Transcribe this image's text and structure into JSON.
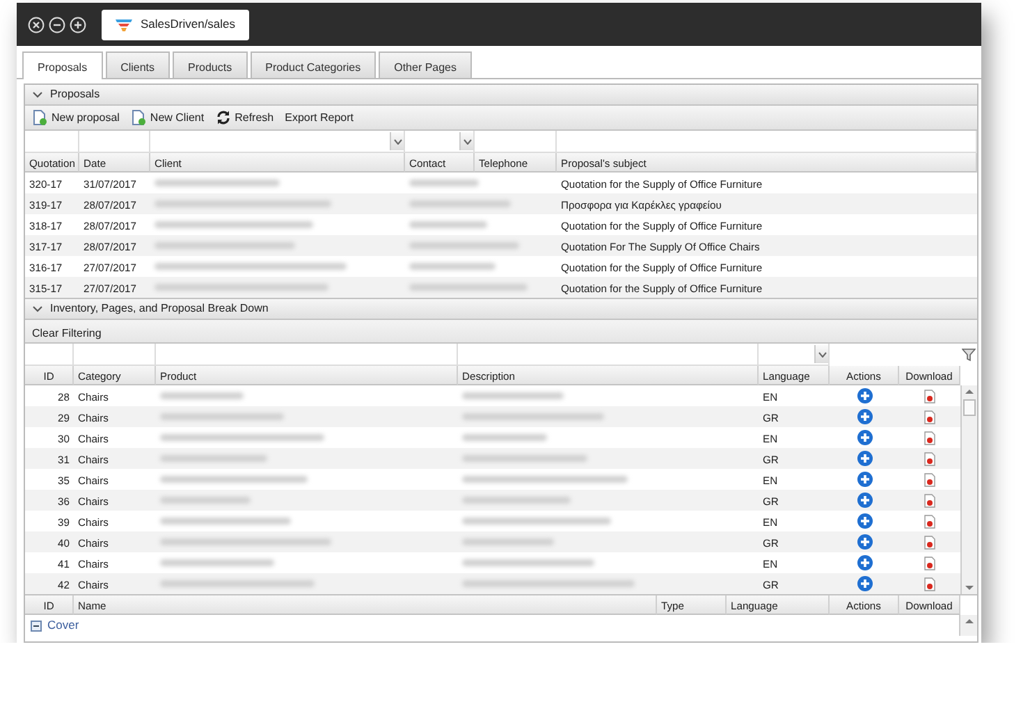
{
  "window": {
    "tab_title": "SalesDriven/sales"
  },
  "tabs": [
    {
      "label": "Proposals",
      "selected": true
    },
    {
      "label": "Clients",
      "selected": false
    },
    {
      "label": "Products",
      "selected": false
    },
    {
      "label": "Product Categories",
      "selected": false
    },
    {
      "label": "Other Pages",
      "selected": false
    }
  ],
  "proposals": {
    "title": "Proposals",
    "expanded": true,
    "toolbar": [
      {
        "label": "New proposal",
        "kind": "new"
      },
      {
        "label": "New Client",
        "kind": "new"
      },
      {
        "label": "Refresh",
        "kind": "refresh"
      },
      {
        "label": "Export Report",
        "kind": "plain"
      }
    ],
    "columns": [
      {
        "label": "Quotation",
        "filter": true,
        "dropdown": false
      },
      {
        "label": "Date",
        "filter": true,
        "dropdown": false
      },
      {
        "label": "Client",
        "filter": true,
        "dropdown": true
      },
      {
        "label": "Contact",
        "filter": true,
        "dropdown": true
      },
      {
        "label": "Telephone",
        "filter": true,
        "dropdown": false
      },
      {
        "label": "Proposal's subject",
        "filter": true,
        "dropdown": false
      }
    ],
    "rows": [
      {
        "quotation": "320-17",
        "date": "31/07/2017",
        "subject": "Quotation for the Supply of Office Furniture"
      },
      {
        "quotation": "319-17",
        "date": "28/07/2017",
        "subject": "Προσφορα για Καρέκλες γραφείου"
      },
      {
        "quotation": "318-17",
        "date": "28/07/2017",
        "subject": "Quotation for the Supply of Office Furniture"
      },
      {
        "quotation": "317-17",
        "date": "28/07/2017",
        "subject": "Quotation For The Supply Of Office Chairs"
      },
      {
        "quotation": "316-17",
        "date": "27/07/2017",
        "subject": "Quotation for the Supply of Office Furniture"
      },
      {
        "quotation": "315-17",
        "date": "27/07/2017",
        "subject": "Quotation for the Supply of Office Furniture"
      }
    ]
  },
  "breakdown": {
    "title": "Inventory, Pages, and Proposal Break Down",
    "expanded": true,
    "clear_label": "Clear Filtering",
    "columns": [
      {
        "label": "ID",
        "filter": true,
        "dropdown": false
      },
      {
        "label": "Category",
        "filter": true,
        "dropdown": false
      },
      {
        "label": "Product",
        "filter": true,
        "dropdown": false
      },
      {
        "label": "Description",
        "filter": true,
        "dropdown": false
      },
      {
        "label": "Language",
        "filter": true,
        "dropdown": true
      },
      {
        "label": "Actions",
        "filter": false
      },
      {
        "label": "Download",
        "filter": false
      }
    ],
    "rows": [
      {
        "id": "28",
        "category": "Chairs",
        "language": "EN"
      },
      {
        "id": "29",
        "category": "Chairs",
        "language": "GR"
      },
      {
        "id": "30",
        "category": "Chairs",
        "language": "EN"
      },
      {
        "id": "31",
        "category": "Chairs",
        "language": "GR"
      },
      {
        "id": "35",
        "category": "Chairs",
        "language": "EN"
      },
      {
        "id": "36",
        "category": "Chairs",
        "language": "GR"
      },
      {
        "id": "39",
        "category": "Chairs",
        "language": "EN"
      },
      {
        "id": "40",
        "category": "Chairs",
        "language": "GR"
      },
      {
        "id": "41",
        "category": "Chairs",
        "language": "EN"
      },
      {
        "id": "42",
        "category": "Chairs",
        "language": "GR"
      }
    ],
    "pages_columns": [
      "ID",
      "Name",
      "Type",
      "Language",
      "Actions",
      "Download"
    ],
    "pages_groups": [
      {
        "label": "Cover",
        "expanded": true
      }
    ]
  }
}
